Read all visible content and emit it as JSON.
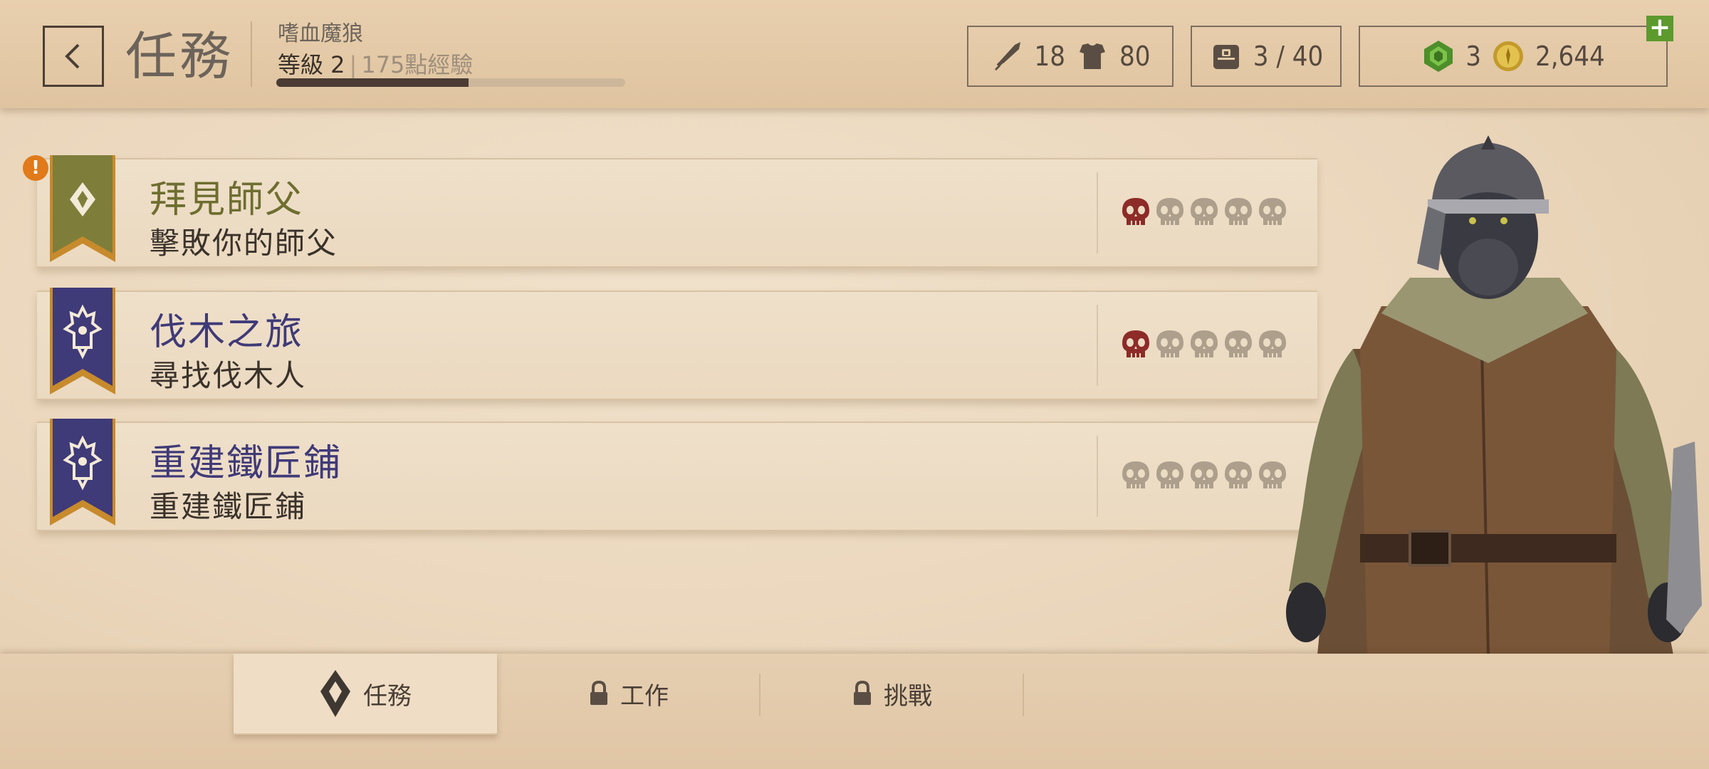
{
  "header": {
    "page_title": "任務",
    "character_name": "嗜血魔狼",
    "level_label": "等級 2",
    "separator": "|",
    "xp_label": "175點經驗",
    "xp_progress": 0.55,
    "attack": "18",
    "armor": "80",
    "inventory": "3 / 40",
    "gems": "3",
    "gold": "2,644"
  },
  "quests": [
    {
      "title": "拜見師父",
      "subtitle": "擊敗你的師父",
      "banner_color": "#7e7e3a",
      "title_color": "#6e6e30",
      "difficulty": 1,
      "alert": true
    },
    {
      "title": "伐木之旅",
      "subtitle": "尋找伐木人",
      "banner_color": "#3f3a78",
      "title_color": "#3f3a78",
      "difficulty": 1,
      "alert": false
    },
    {
      "title": "重建鐵匠鋪",
      "subtitle": "重建鐵匠鋪",
      "banner_color": "#3f3a78",
      "title_color": "#3f3a78",
      "difficulty": 0,
      "alert": false
    }
  ],
  "alert_mark": "!",
  "colors": {
    "skull_active": "#8d2b28",
    "skull_inactive": "#ad9f8c",
    "gem": "#5ba136",
    "gold": "#d7b23a"
  },
  "tabs": [
    {
      "label": "任務",
      "icon": "quest-icon",
      "active": true
    },
    {
      "label": "工作",
      "icon": "lock-icon",
      "active": false
    },
    {
      "label": "挑戰",
      "icon": "lock-icon",
      "active": false
    }
  ]
}
